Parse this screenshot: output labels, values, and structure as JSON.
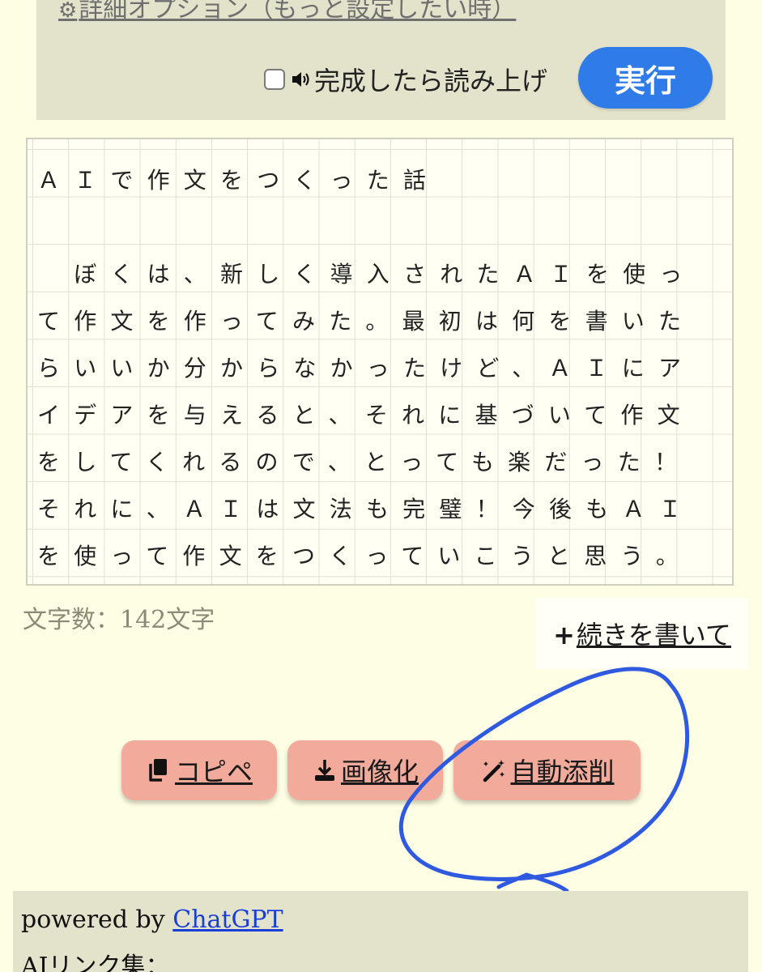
{
  "options": {
    "advanced_link": "詳細オプション（もっと設定したい時）",
    "read_aloud_label": "完成したら読み上げ",
    "read_aloud_checked": false,
    "run_button": "実行"
  },
  "manuscript": {
    "lines": [
      "ＡＩで作文をつくった話",
      "",
      "　ぼくは、新しく導入されたＡＩを使っ",
      "て作文を作ってみた。最初は何を書いた",
      "らいいか分からなかったけど、ＡＩにア",
      "イデアを与えると、それに基づいて作文",
      "をしてくれるので、とっても楽だった！",
      "それに、ＡＩは文法も完璧！今後もＡＩ",
      "を使って作文をつくっていこうと思う。"
    ]
  },
  "char_count": "文字数：142文字",
  "continue_link": "続きを書いて",
  "actions": {
    "copy": "コピペ",
    "image": "画像化",
    "correct": "自動添削"
  },
  "footer": {
    "powered_prefix": "powered by ",
    "powered_link": "ChatGPT",
    "ai_links": "AIリンク集："
  },
  "colors": {
    "background": "#fefee4",
    "panel": "#e3e3cb",
    "run_button": "#2f7be8",
    "action_button": "#f2aa9b",
    "annotation": "#2f5ae0",
    "link": "#1a3fd8"
  }
}
